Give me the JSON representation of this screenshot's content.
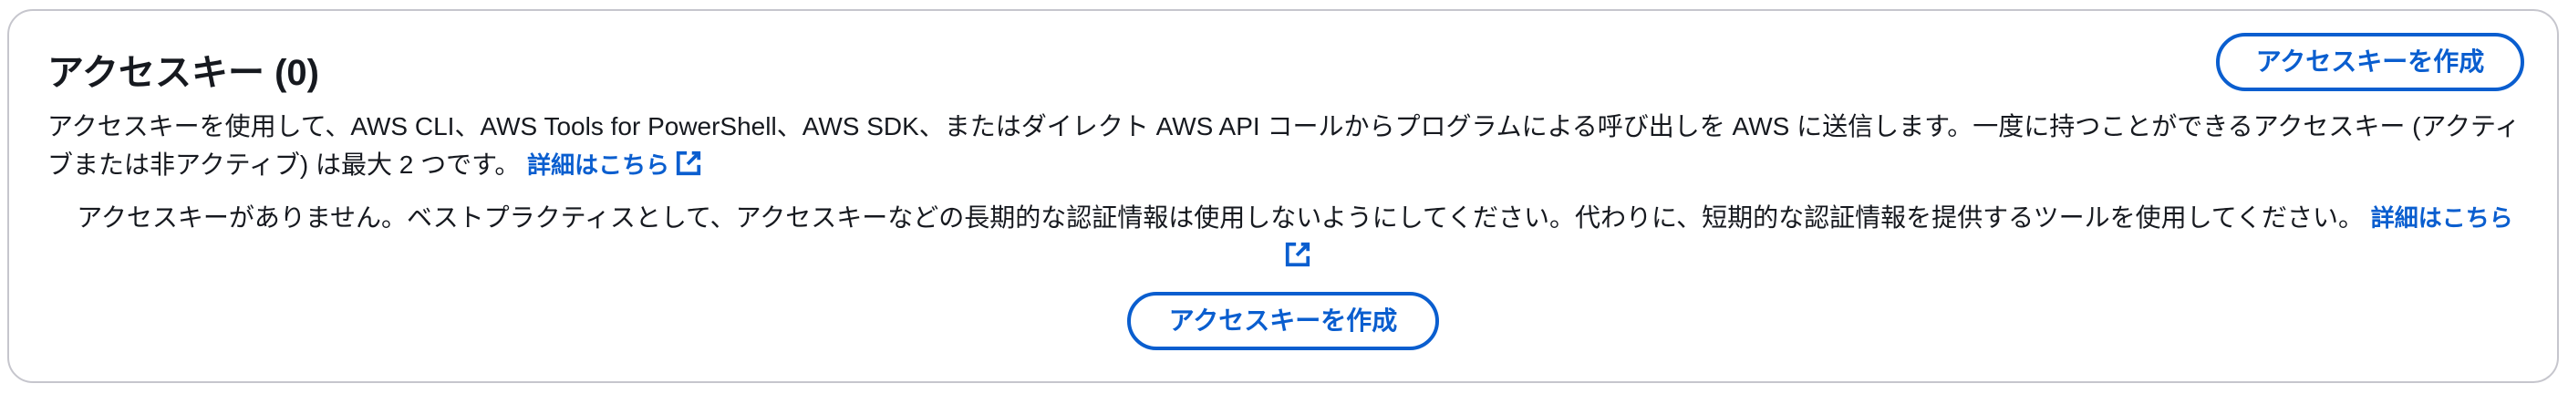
{
  "header": {
    "title": "アクセスキー (0)",
    "create_button_label": "アクセスキーを作成"
  },
  "description": {
    "text": "アクセスキーを使用して、AWS CLI、AWS Tools for PowerShell、AWS SDK、またはダイレクト AWS API コールからプログラムによる呼び出しを AWS に送信します。一度に持つことができるアクセスキー (アクティブまたは非アクティブ) は最大 2 つです。",
    "learn_more_label": "詳細はこちら",
    "learn_more_icon": "external-link-icon"
  },
  "empty_state": {
    "text": "アクセスキーがありません。ベストプラクティスとして、アクセスキーなどの長期的な認証情報は使用しないようにしてください。代わりに、短期的な認証情報を提供するツールを使用してください。",
    "learn_more_label": "詳細はこちら",
    "learn_more_icon": "external-link-icon",
    "create_button_label": "アクセスキーを作成"
  },
  "colors": {
    "link": "#0a5ecf",
    "text": "#16191f",
    "border": "#c6c6cd"
  }
}
